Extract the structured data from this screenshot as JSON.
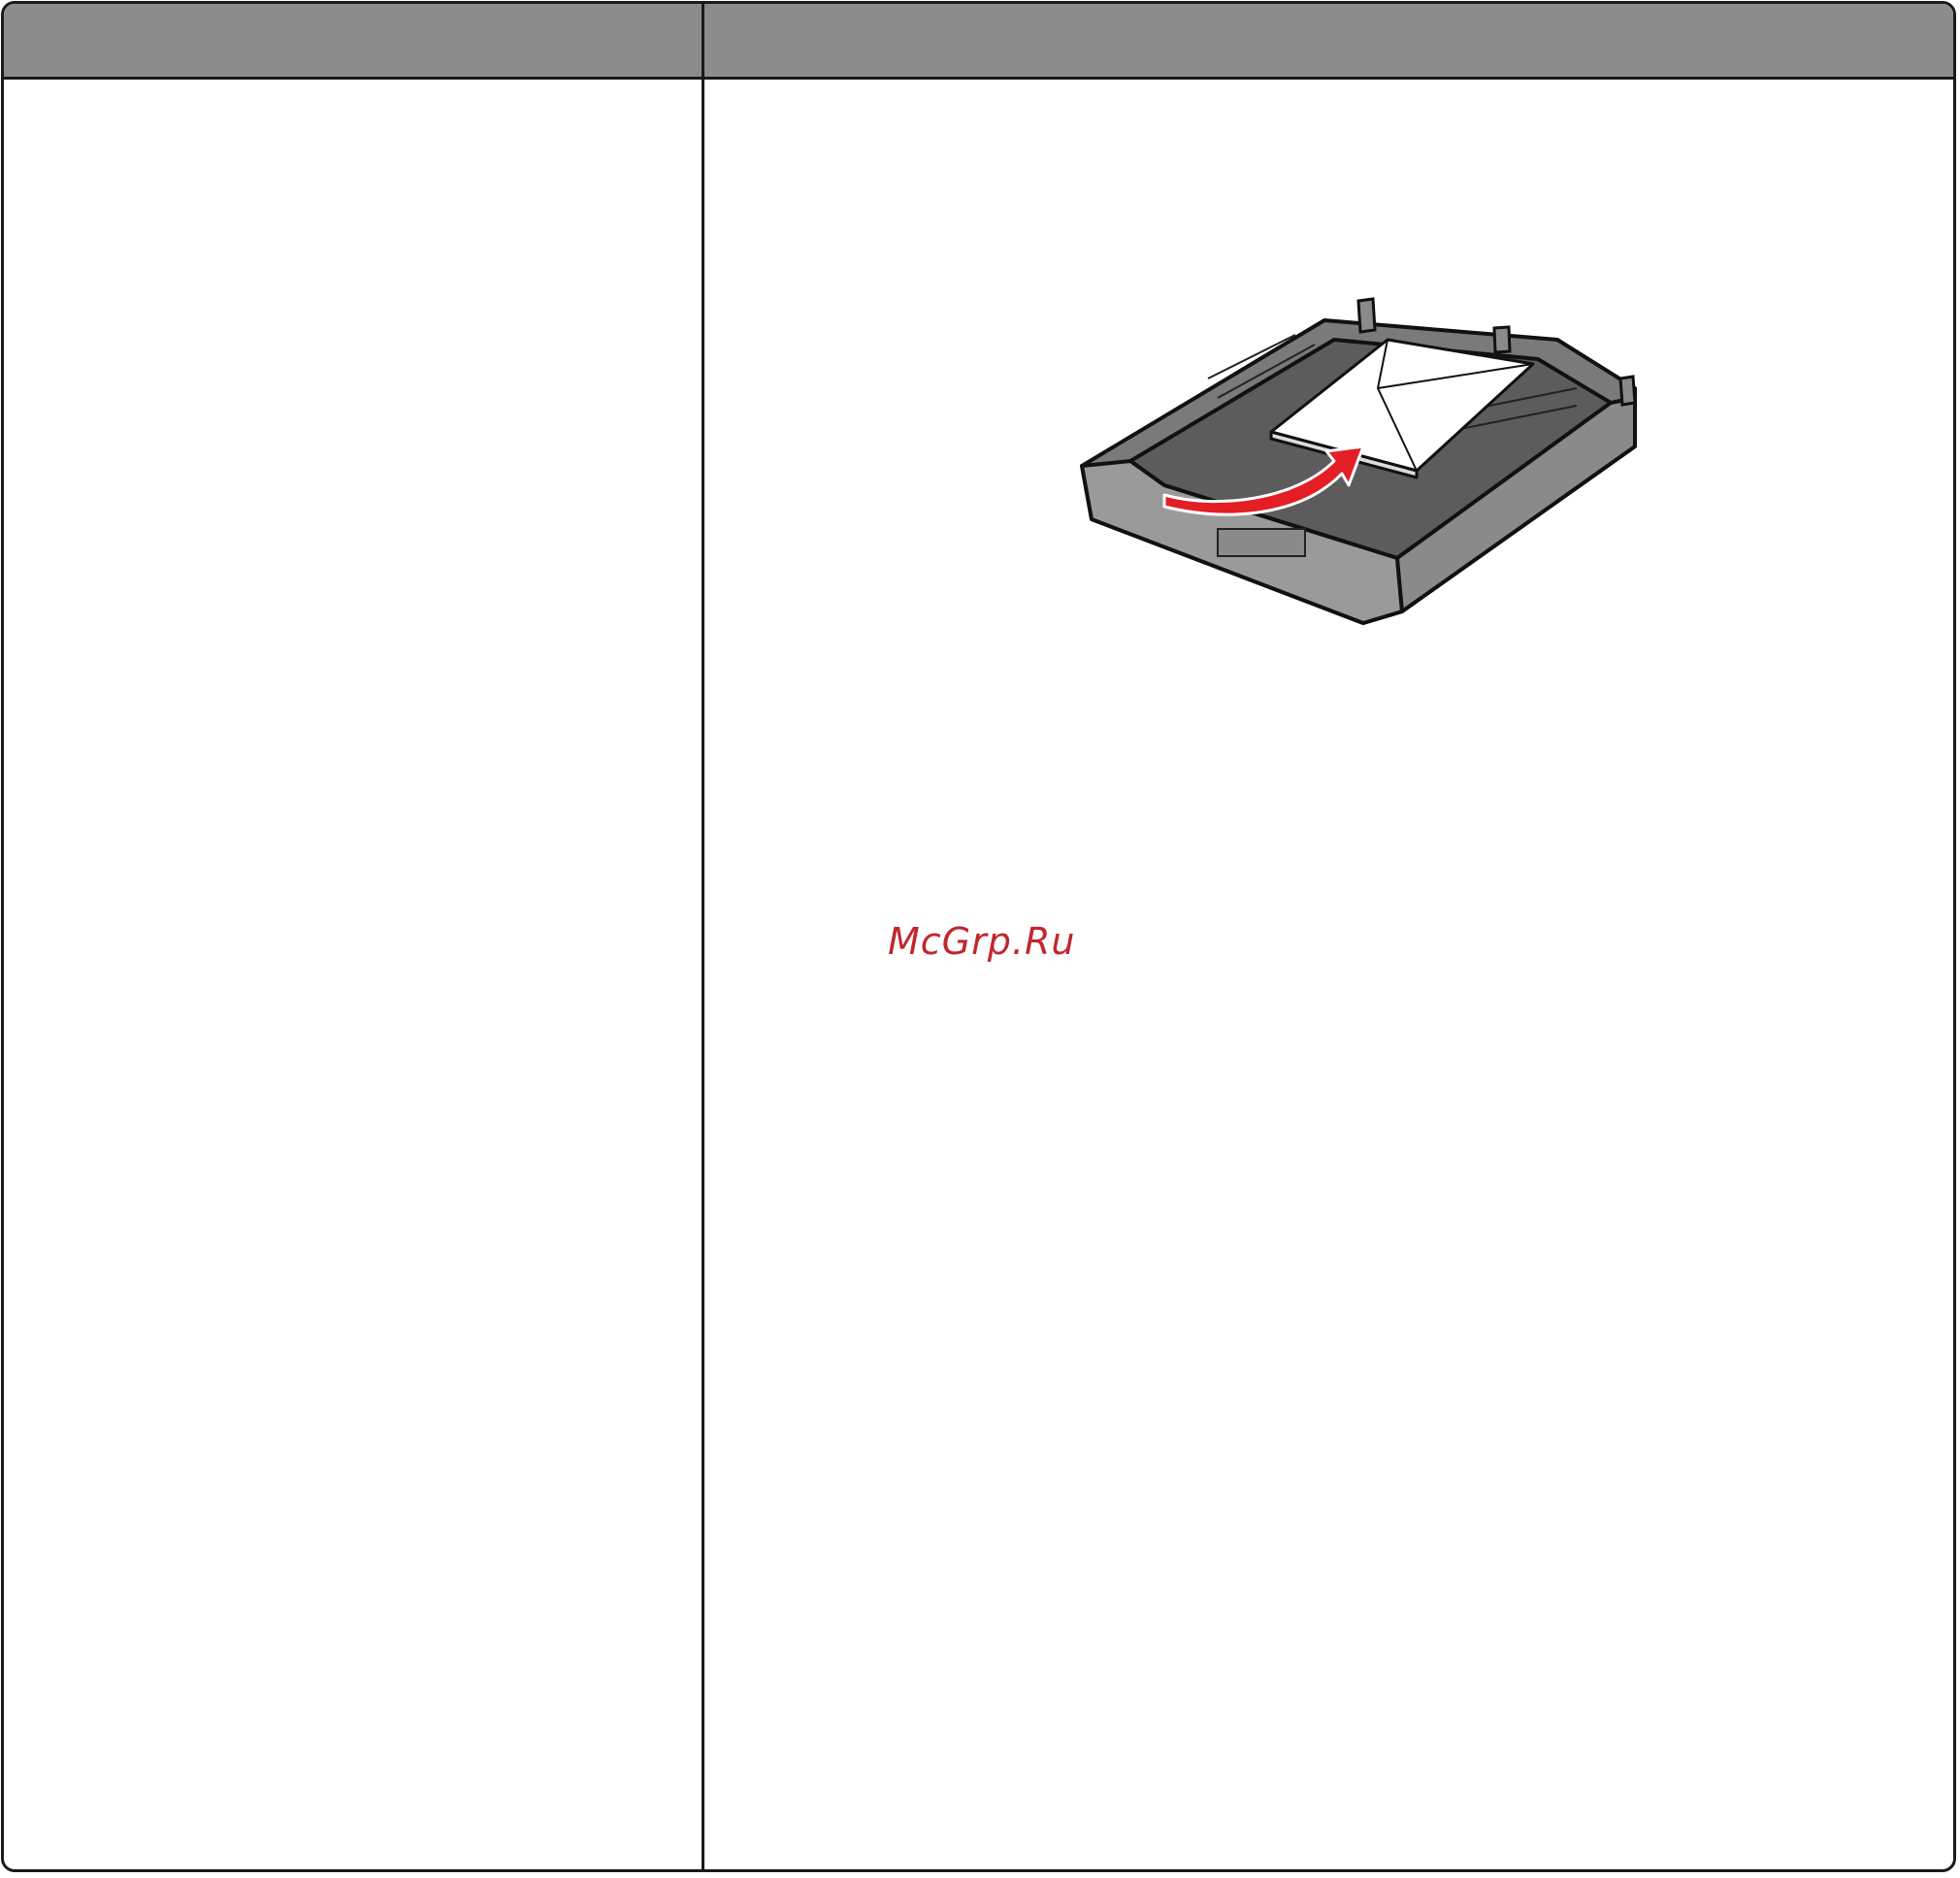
{
  "table": {
    "header_left": "",
    "header_right": ""
  },
  "illustration": {
    "icon": "paper-tray-envelope-icon",
    "arrow_color": "#e31e24",
    "tray_color": "#5c5c5c"
  },
  "watermark": {
    "text": "McGrp.Ru",
    "color": "#c0272d"
  }
}
